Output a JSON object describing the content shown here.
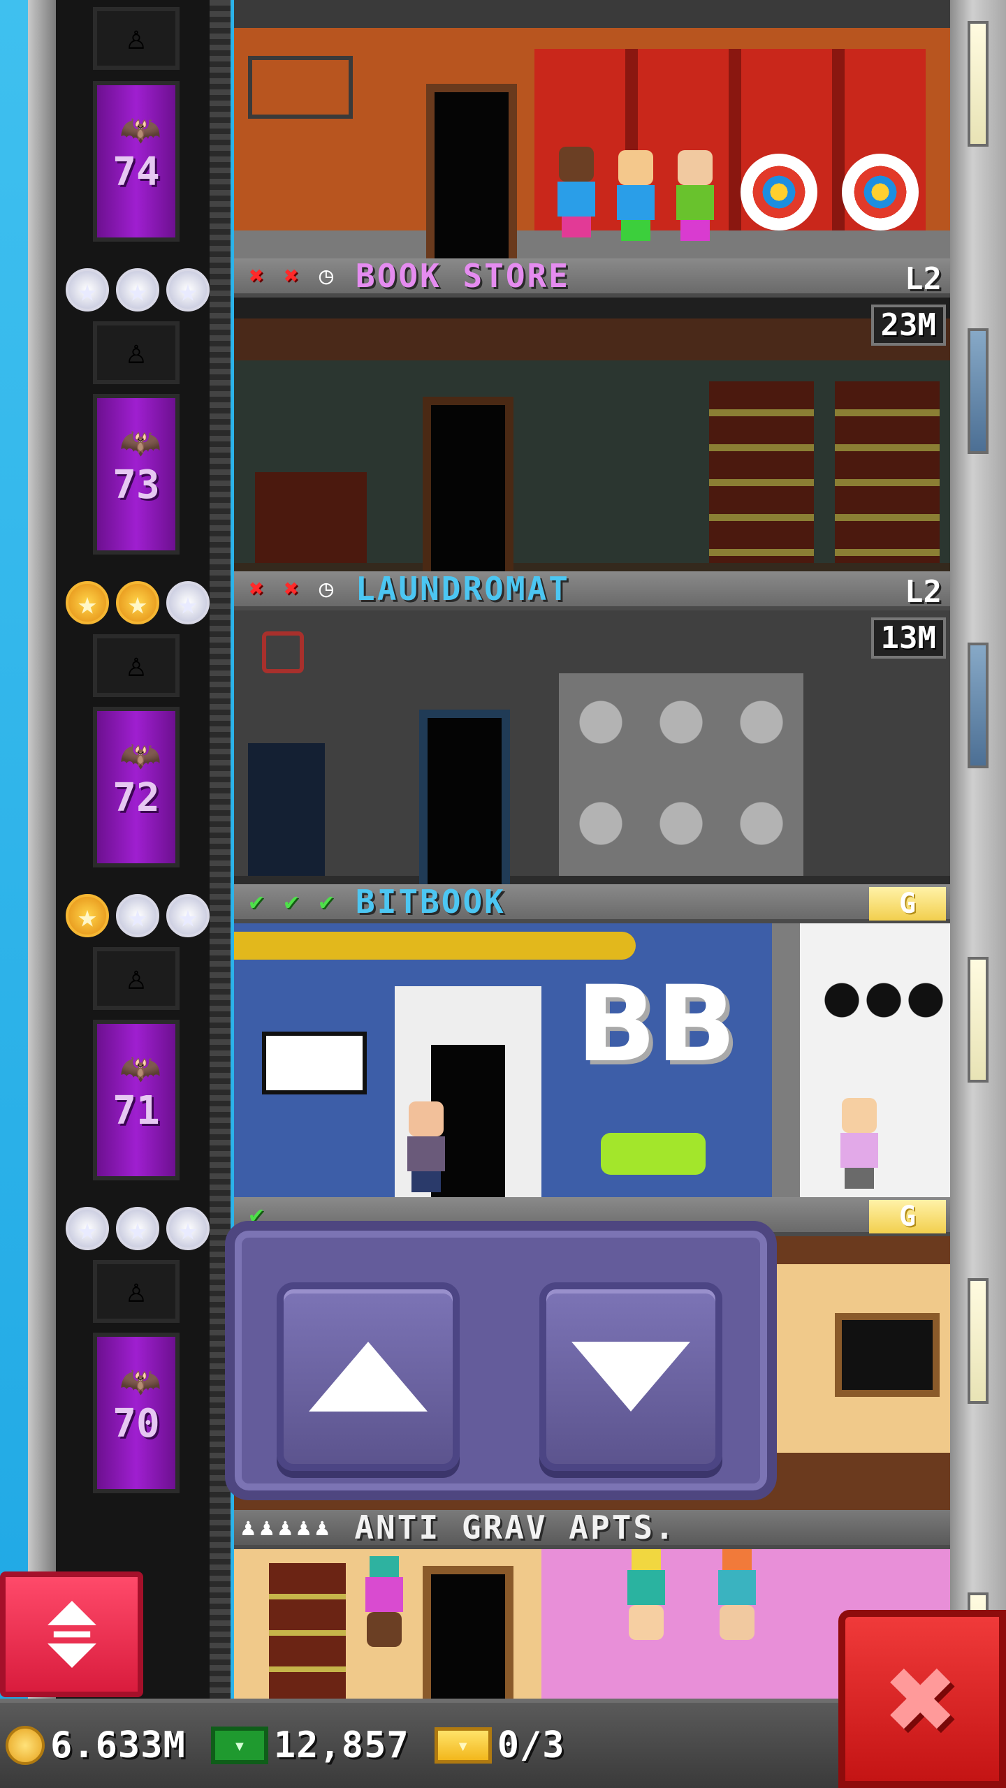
{
  "floors": [
    {
      "floor_number": "74",
      "name": "",
      "level": "",
      "stars": [
        "silver",
        "silver",
        "silver"
      ],
      "status": []
    },
    {
      "floor_number": "73",
      "name": "BOOK STORE",
      "name_color": "#e58cf0",
      "level": "L2",
      "price": "23M",
      "stars": [
        "silver",
        "silver",
        "silver"
      ],
      "status": [
        "x",
        "x",
        "clock"
      ]
    },
    {
      "floor_number": "72",
      "name": "LAUNDROMAT",
      "name_color": "#4cc6f2",
      "level": "L2",
      "price": "13M",
      "stars": [
        "gold",
        "gold",
        "silver"
      ],
      "status": [
        "x",
        "x",
        "clock"
      ]
    },
    {
      "floor_number": "71",
      "name": "BITBOOK",
      "name_color": "#4cc6f2",
      "badge": "G",
      "logo_text": "BB",
      "stars": [
        "gold",
        "silver",
        "silver"
      ],
      "status": [
        "check",
        "check",
        "check"
      ]
    },
    {
      "floor_number": "70",
      "name": "",
      "badge": "G",
      "stars": [
        "silver",
        "silver",
        "silver"
      ],
      "status": [
        "check"
      ]
    },
    {
      "floor_number": "",
      "name": "ANTI GRAV APTS.",
      "name_color": "#f2f2f2",
      "residents_icons": "♟♟♟♟♟"
    }
  ],
  "elevator_panel": {
    "up_label": "up",
    "down_label": "down"
  },
  "status_bar": {
    "coins": "6.633M",
    "bux": "12,857",
    "tickets": "0/3"
  },
  "icons": {
    "elevator_toggle": "up-down-arrows-icon",
    "close": "close-icon",
    "coin": "coin-icon",
    "bux": "bux-icon",
    "ticket": "golden-ticket-icon"
  }
}
